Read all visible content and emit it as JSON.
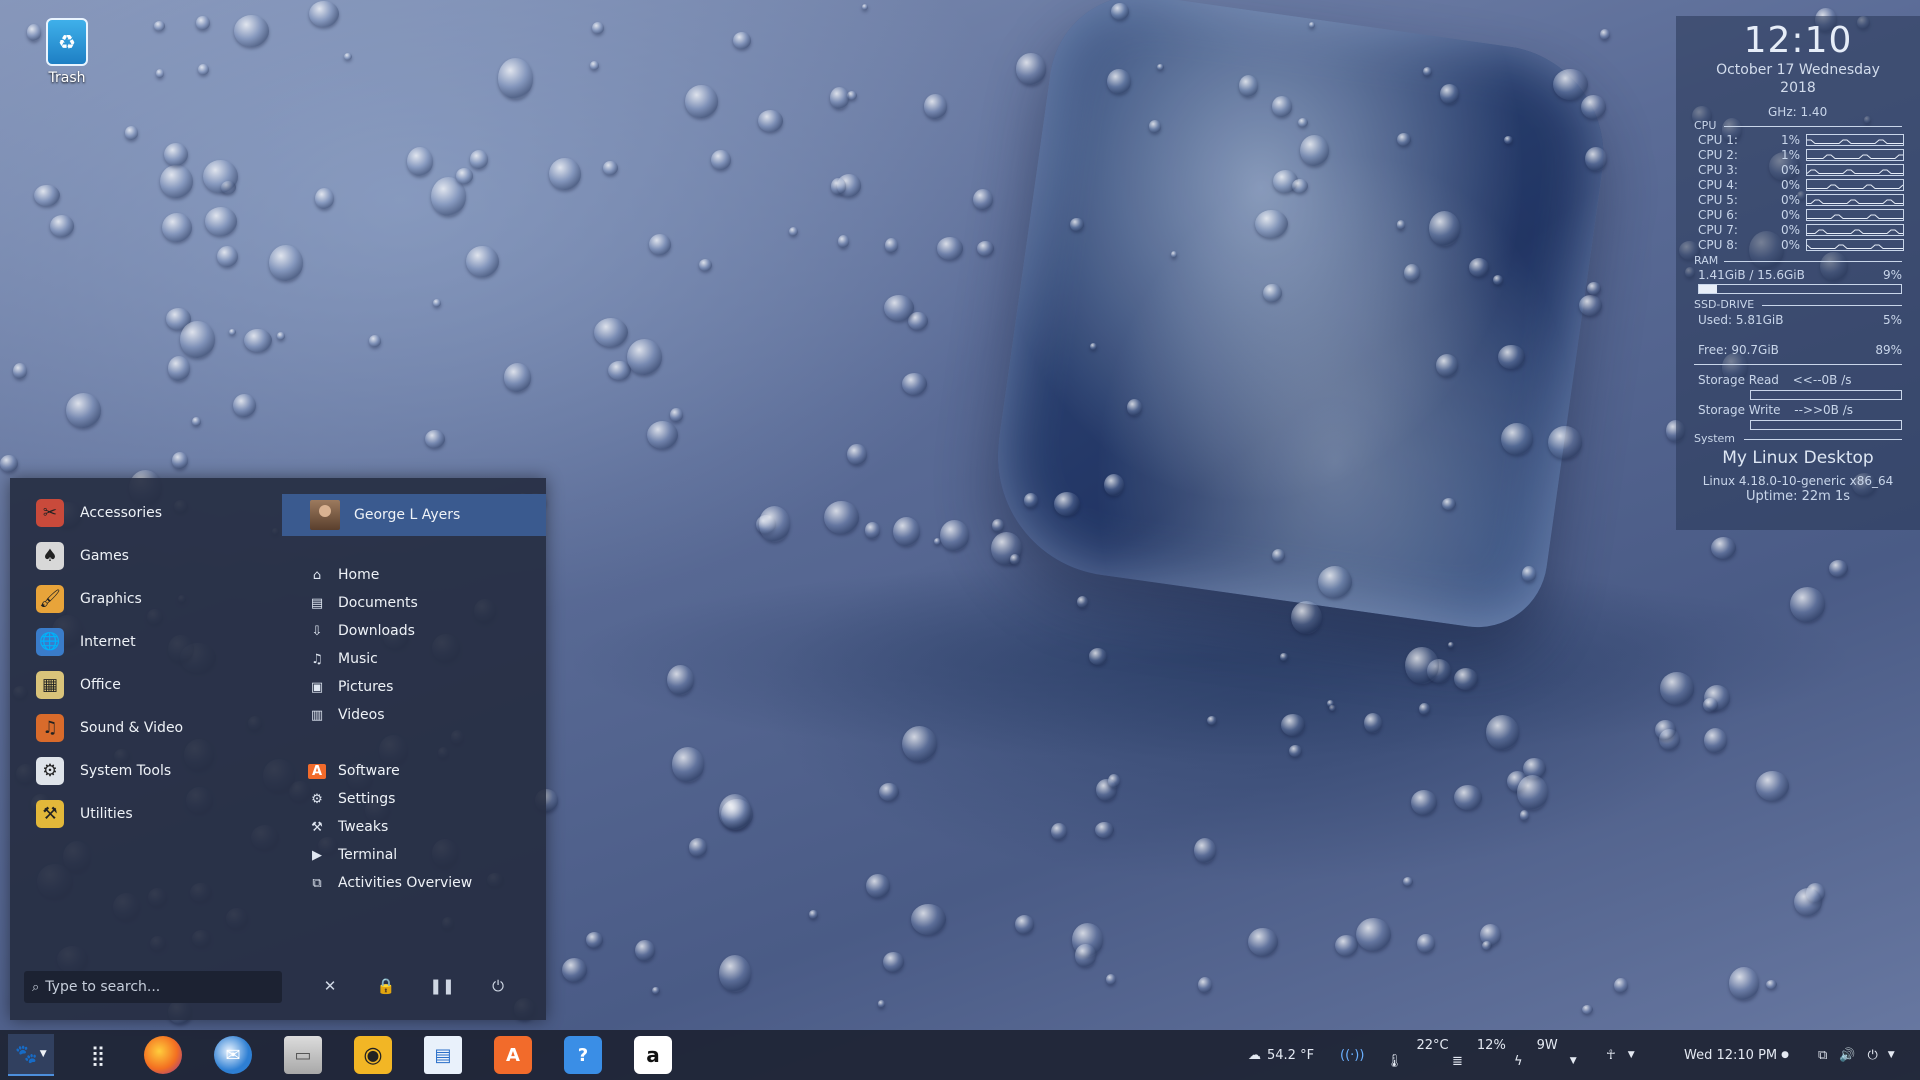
{
  "desktop": {
    "trash_label": "Trash"
  },
  "conky": {
    "time": "12:10",
    "date_line": "October 17 Wednesday",
    "year": "2018",
    "ghz": "GHz: 1.40",
    "cpu_header": "CPU",
    "cpus": [
      {
        "label": "CPU 1:",
        "value": "1%"
      },
      {
        "label": "CPU 2:",
        "value": "1%"
      },
      {
        "label": "CPU 3:",
        "value": "0%"
      },
      {
        "label": "CPU 4:",
        "value": "0%"
      },
      {
        "label": "CPU 5:",
        "value": "0%"
      },
      {
        "label": "CPU 6:",
        "value": "0%"
      },
      {
        "label": "CPU 7:",
        "value": "0%"
      },
      {
        "label": "CPU 8:",
        "value": "0%"
      }
    ],
    "ram_header": "RAM",
    "ram_text": "1.41GiB / 15.6GiB",
    "ram_pct": "9%",
    "ram_fraction": 0.09,
    "ssd_header": "SSD-DRIVE",
    "used_label": "Used:  5.81GiB",
    "used_pct": "5%",
    "free_label": "Free:  90.7GiB",
    "free_pct": "89%",
    "storage_read": "Storage Read",
    "storage_read_val": "<<--0B  /s",
    "storage_write": "Storage Write",
    "storage_write_val": "-->>0B  /s",
    "system_header": "System",
    "system_name": "My Linux Desktop",
    "kernel": "Linux 4.18.0-10-generic x86_64",
    "uptime": "Uptime: 22m 1s"
  },
  "menu": {
    "categories": [
      {
        "label": "Accessories",
        "icon": "accessories-icon"
      },
      {
        "label": "Games",
        "icon": "games-icon"
      },
      {
        "label": "Graphics",
        "icon": "graphics-icon"
      },
      {
        "label": "Internet",
        "icon": "internet-icon"
      },
      {
        "label": "Office",
        "icon": "office-icon"
      },
      {
        "label": "Sound & Video",
        "icon": "sound-video-icon"
      },
      {
        "label": "System Tools",
        "icon": "system-tools-icon"
      },
      {
        "label": "Utilities",
        "icon": "utilities-icon"
      }
    ],
    "user_name": "George L Ayers",
    "places": [
      {
        "label": "Home",
        "icon": "home-icon"
      },
      {
        "label": "Documents",
        "icon": "documents-icon"
      },
      {
        "label": "Downloads",
        "icon": "downloads-icon"
      },
      {
        "label": "Music",
        "icon": "music-icon"
      },
      {
        "label": "Pictures",
        "icon": "pictures-icon"
      },
      {
        "label": "Videos",
        "icon": "videos-icon"
      }
    ],
    "system": [
      {
        "label": "Software",
        "icon": "software-icon"
      },
      {
        "label": "Settings",
        "icon": "settings-icon"
      },
      {
        "label": "Tweaks",
        "icon": "tweaks-icon"
      },
      {
        "label": "Terminal",
        "icon": "terminal-icon"
      },
      {
        "label": "Activities Overview",
        "icon": "activities-icon"
      }
    ],
    "search_placeholder": "Type to search..."
  },
  "taskbar": {
    "weather": "54.2 °F",
    "temp": "22°C",
    "disk_pct": "12%",
    "power": "9W",
    "clock": "Wed 12:10 PM"
  }
}
